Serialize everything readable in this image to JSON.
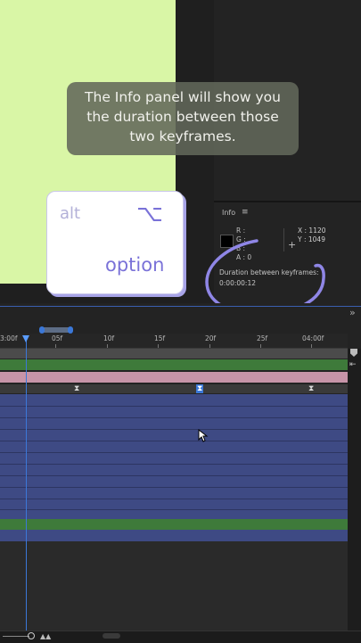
{
  "tooltip": {
    "line1": "The Info panel will show you",
    "line2": "the duration between those",
    "line3": "two keyframes."
  },
  "option_key": {
    "alt_label": "alt",
    "symbol": "⌥",
    "option_label": "option"
  },
  "info_panel": {
    "title": "Info",
    "menu_glyph": "≡",
    "r_label": "R :",
    "g_label": "G :",
    "b_label": "B :",
    "a_label": "A :  0",
    "x_label": "X : 1120",
    "y_label": "Y : 1049",
    "duration_label": "Duration between keyframes:",
    "duration_value": "0:00:00:12"
  },
  "timeline": {
    "ruler_labels": [
      "3:00f",
      "05f",
      "10f",
      "15f",
      "20f",
      "25f",
      "04:00f"
    ],
    "collapse_glyph": "»",
    "keyframe_glyph": "⧗"
  },
  "colors": {
    "canvas": "#d9f6a6",
    "key_accent": "#7a72d8",
    "annotation_circle": "#8f86e6",
    "playhead": "#3b78d8",
    "layer_blue": "#3e4a84",
    "layer_green": "#3e7a3a",
    "layer_pink": "#c794a8"
  }
}
